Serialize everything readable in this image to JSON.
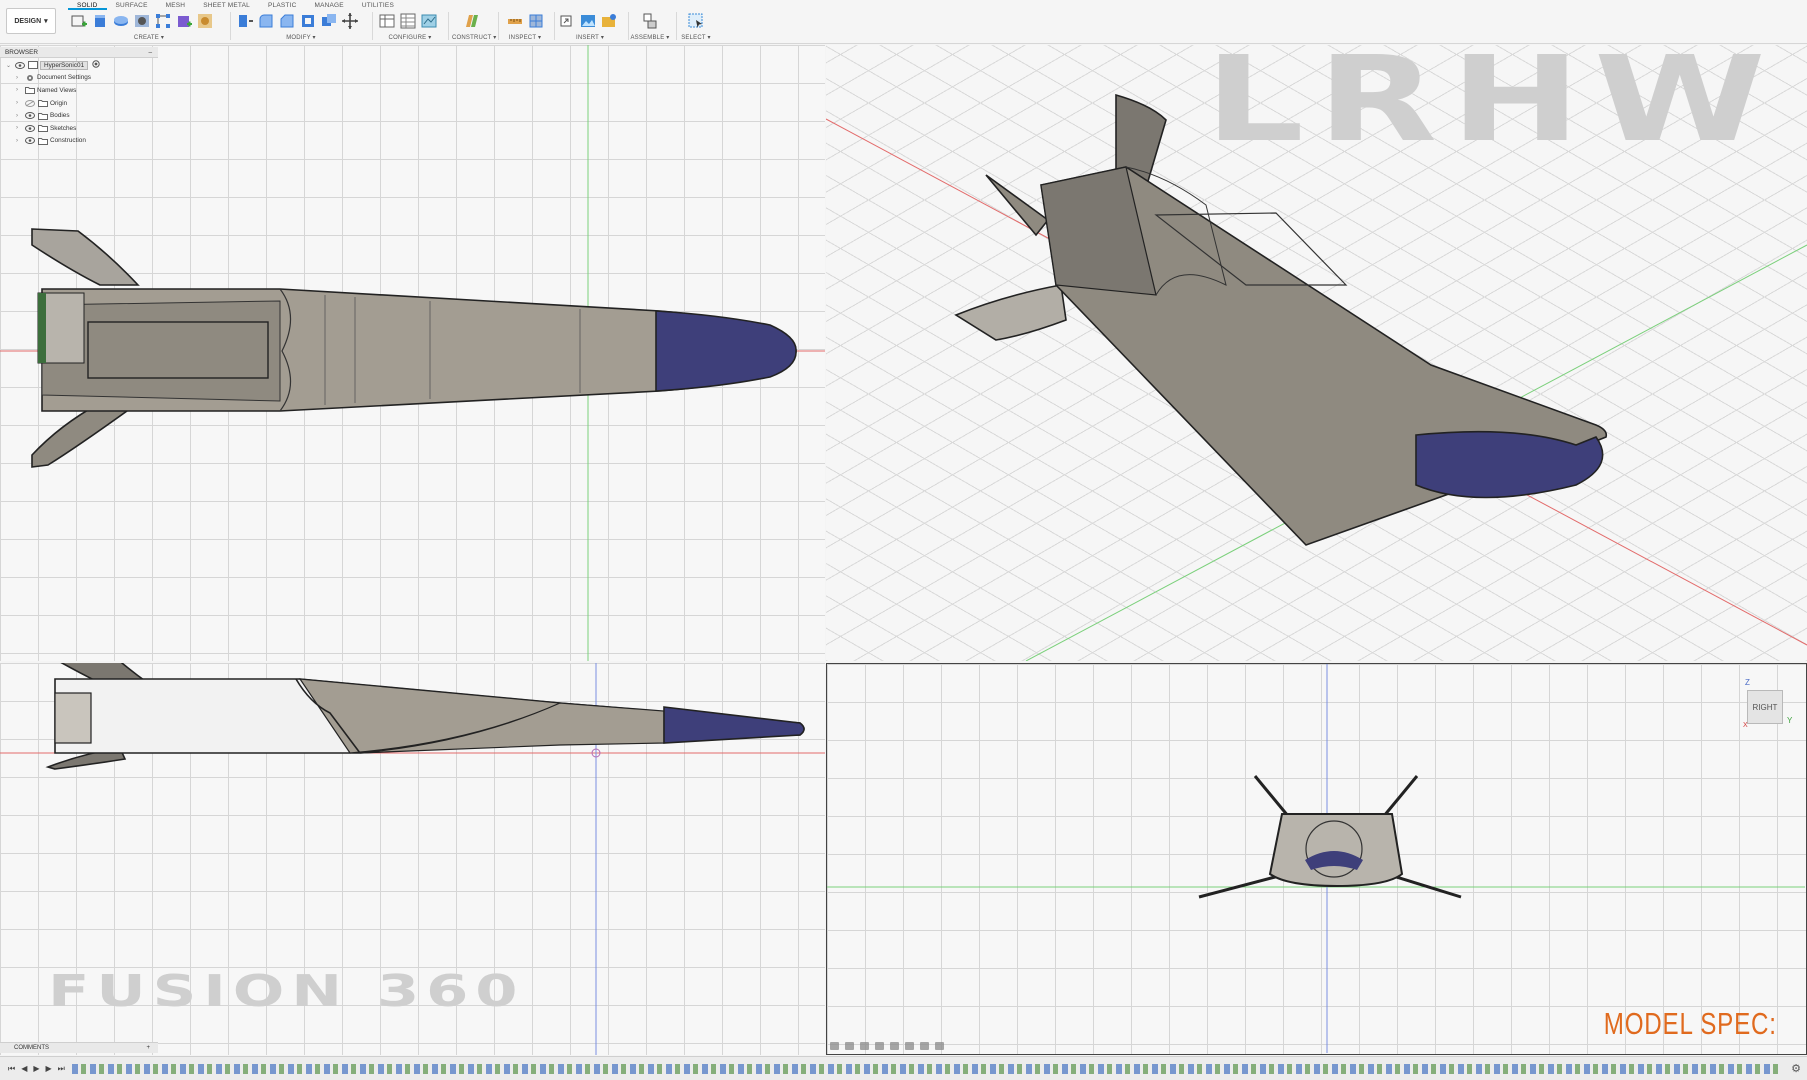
{
  "toolbar": {
    "workspace_label": "DESIGN",
    "tabs": [
      "SOLID",
      "SURFACE",
      "MESH",
      "SHEET METAL",
      "PLASTIC",
      "MANAGE",
      "UTILITIES"
    ],
    "groups": {
      "create": "CREATE",
      "modify": "MODIFY",
      "configure": "CONFIGURE",
      "construct": "CONSTRUCT",
      "inspect": "INSPECT",
      "insert": "INSERT",
      "assemble": "ASSEMBLE",
      "select": "SELECT"
    }
  },
  "browser": {
    "header": "BROWSER",
    "collapse_icon": "minus-icon",
    "root": "HyperSonic01",
    "items": [
      "Document Settings",
      "Named Views",
      "Origin",
      "Bodies",
      "Sketches",
      "Construction"
    ]
  },
  "overlay": {
    "title_top": "LRHW",
    "title_bottom": "FUSION 360",
    "spec": "MODEL SPEC:"
  },
  "viewcube": {
    "face": "RIGHT",
    "z": "Z",
    "y": "Y",
    "x": "X"
  },
  "comments": {
    "label": "COMMENTS",
    "add": "+"
  },
  "colors": {
    "body_fill": "#8f8a80",
    "nose_fill": "#3e3f7a",
    "outline": "#222222",
    "axis_red": "#e36b6b",
    "axis_green": "#7bd07b",
    "axis_blue": "#7b8fe0",
    "accent": "#e06a1e"
  },
  "timeline": {
    "controls": [
      "skip-start-icon",
      "step-back-icon",
      "play-icon",
      "step-forward-icon",
      "skip-end-icon"
    ],
    "settings_icon": "gear-icon"
  }
}
